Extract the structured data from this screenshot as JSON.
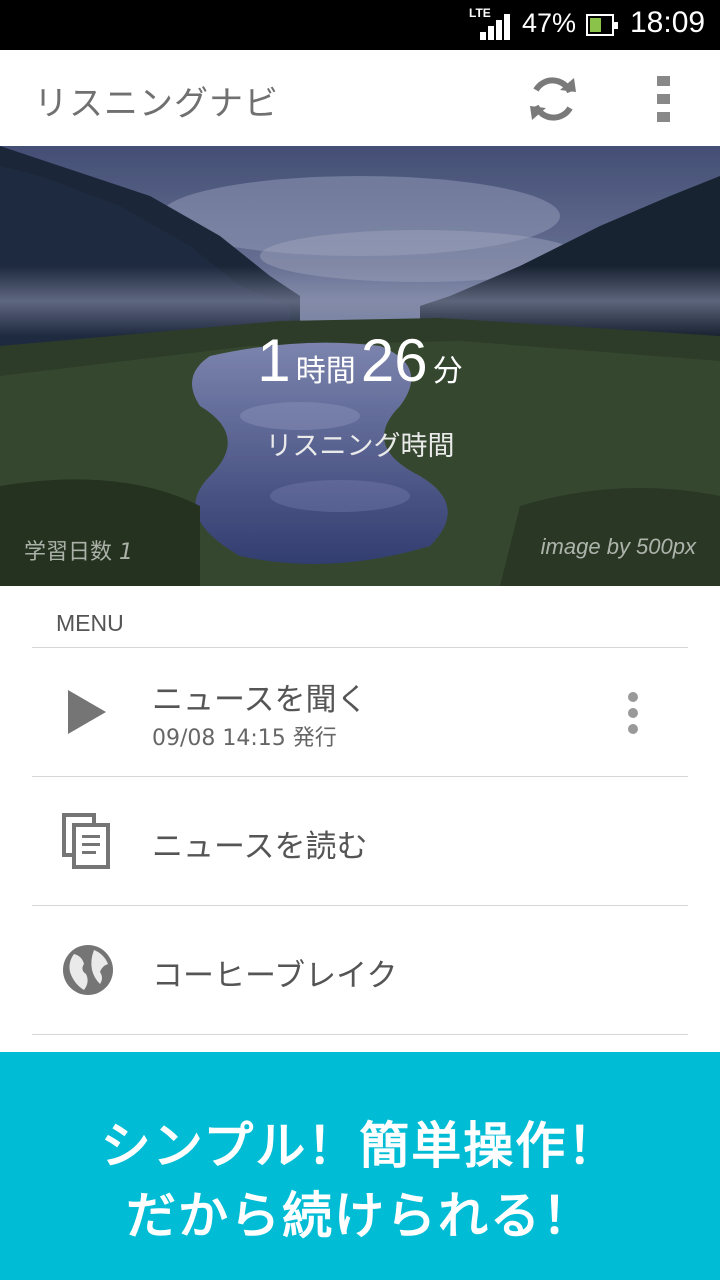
{
  "status_bar": {
    "network": "LTE",
    "battery_percent": "47%",
    "battery_level": 0.47,
    "time": "18:09"
  },
  "app_bar": {
    "title": "リスニングナビ",
    "refresh_icon": "refresh-icon",
    "overflow_icon": "more-vert-icon"
  },
  "hero": {
    "hours": "1",
    "hours_unit": "時間",
    "minutes": "26",
    "minutes_unit": "分",
    "label": "リスニング時間",
    "days_label": "学習日数",
    "days_value": "1",
    "credit": "image by 500px"
  },
  "menu": {
    "header": "MENU",
    "items": [
      {
        "title": "ニュースを聞く",
        "subtitle": "09/08 14:15 発行",
        "icon": "play-icon"
      },
      {
        "title": "ニュースを読む",
        "icon": "documents-icon"
      },
      {
        "title": "コーヒーブレイク",
        "icon": "globe-icon"
      }
    ]
  },
  "banner": {
    "line1": "シンプル！簡単操作！",
    "line2": "だから続けられる！"
  },
  "colors": {
    "accent": "#00bcd4",
    "icon_gray": "#757575",
    "text_gray": "#555555"
  }
}
